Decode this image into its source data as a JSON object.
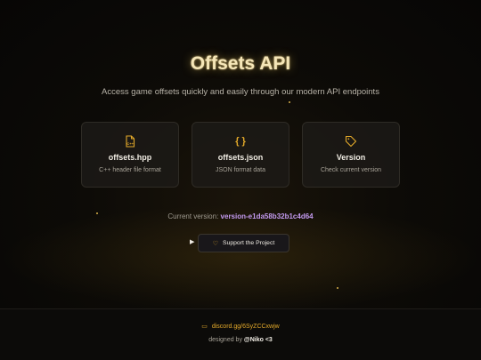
{
  "hero": {
    "title": "Offsets API",
    "subtitle": "Access game offsets quickly and easily through our modern API endpoints"
  },
  "cards": [
    {
      "icon": "file-code-icon",
      "title": "offsets.hpp",
      "description": "C++ header file format"
    },
    {
      "icon": "braces-icon",
      "title": "offsets.json",
      "description": "JSON format data"
    },
    {
      "icon": "tag-icon",
      "title": "Version",
      "description": "Check current version"
    }
  ],
  "version": {
    "label": "Current version:",
    "value": "version-e1da58b32b1c4d64"
  },
  "support": {
    "label": "Support the Project",
    "icon": "heart-icon",
    "play_icon": "play-icon"
  },
  "footer": {
    "discord_text": "discord.gg/6SyZCCxwjw",
    "discord_icon": "chat-icon",
    "credit_prefix": "designed by ",
    "author": "@Niko <3"
  },
  "colors": {
    "accent": "#e3a92a",
    "version": "#c39af0",
    "background": "#0d0b07"
  }
}
